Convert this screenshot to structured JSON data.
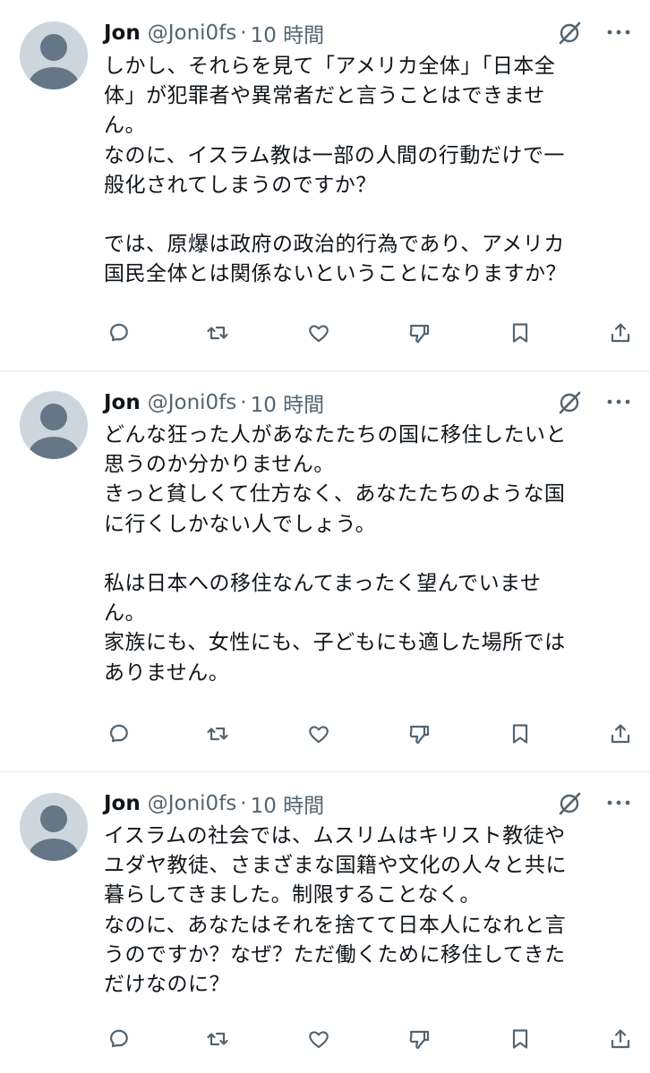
{
  "tweets": [
    {
      "author": "Jon",
      "handle": "@Joni0fs",
      "separator": "·",
      "time": "10 時間",
      "text": "しかし、それらを見て「アメリカ全体」「日本全\n体」が犯罪者や異常者だと言うことはできませ\nん。\nなのに、イスラム教は一部の人間の行動だけで一\n般化されてしまうのですか？\n\nでは、原爆は政府の政治的行為であり、アメリカ\n国民全体とは関係ないということになりますか？"
    },
    {
      "author": "Jon",
      "handle": "@Joni0fs",
      "separator": "·",
      "time": "10 時間",
      "text": "どんな狂った人があなたたちの国に移住したいと\n思うのか分かりません。\nきっと貧しくて仕方なく、あなたたちのような国\nに行くしかない人でしょう。\n\n私は日本への移住なんてまったく望んでいませ\nん。\n家族にも、女性にも、子どもにも適した場所では\nありません。"
    },
    {
      "author": "Jon",
      "handle": "@Joni0fs",
      "separator": "·",
      "time": "10 時間",
      "text": "イスラムの社会では、ムスリムはキリスト教徒や\nユダヤ教徒、さまざまな国籍や文化の人々と共に\n暮らしてきました。制限することなく。\nなのに、あなたはそれを捨てて日本人になれと言\nうのですか？なぜ？ただ働くために移住してきた\nだけなのに？"
    }
  ],
  "icons": {
    "header": [
      "grok-icon",
      "more-icon"
    ],
    "actions": [
      "reply-icon",
      "repost-icon",
      "like-icon",
      "downvote-icon",
      "bookmark-icon",
      "share-icon"
    ]
  },
  "colors": {
    "icon": "#536471",
    "divider": "#e6e8ea",
    "avatar_bg": "#cdd6dd",
    "avatar_fg": "#657786"
  }
}
